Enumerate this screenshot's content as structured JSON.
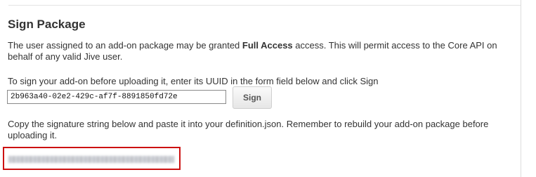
{
  "section": {
    "title": "Sign Package",
    "description_prefix": "The user assigned to an add-on package may be granted ",
    "description_bold": "Full Access",
    "description_suffix": " access. This will permit access to the Core API on behalf of any valid Jive user."
  },
  "sign_form": {
    "instruction": "To sign your add-on before uploading it, enter its UUID in the form field below and click Sign",
    "uuid_value": "2b963a40-02e2-429c-af7f-8891850fd72e",
    "sign_label": "Sign"
  },
  "signature": {
    "instruction": "Copy the signature string below and paste it into your definition.json. Remember to rebuild your add-on package before uploading it.",
    "highlight_color": "#cc1111"
  }
}
